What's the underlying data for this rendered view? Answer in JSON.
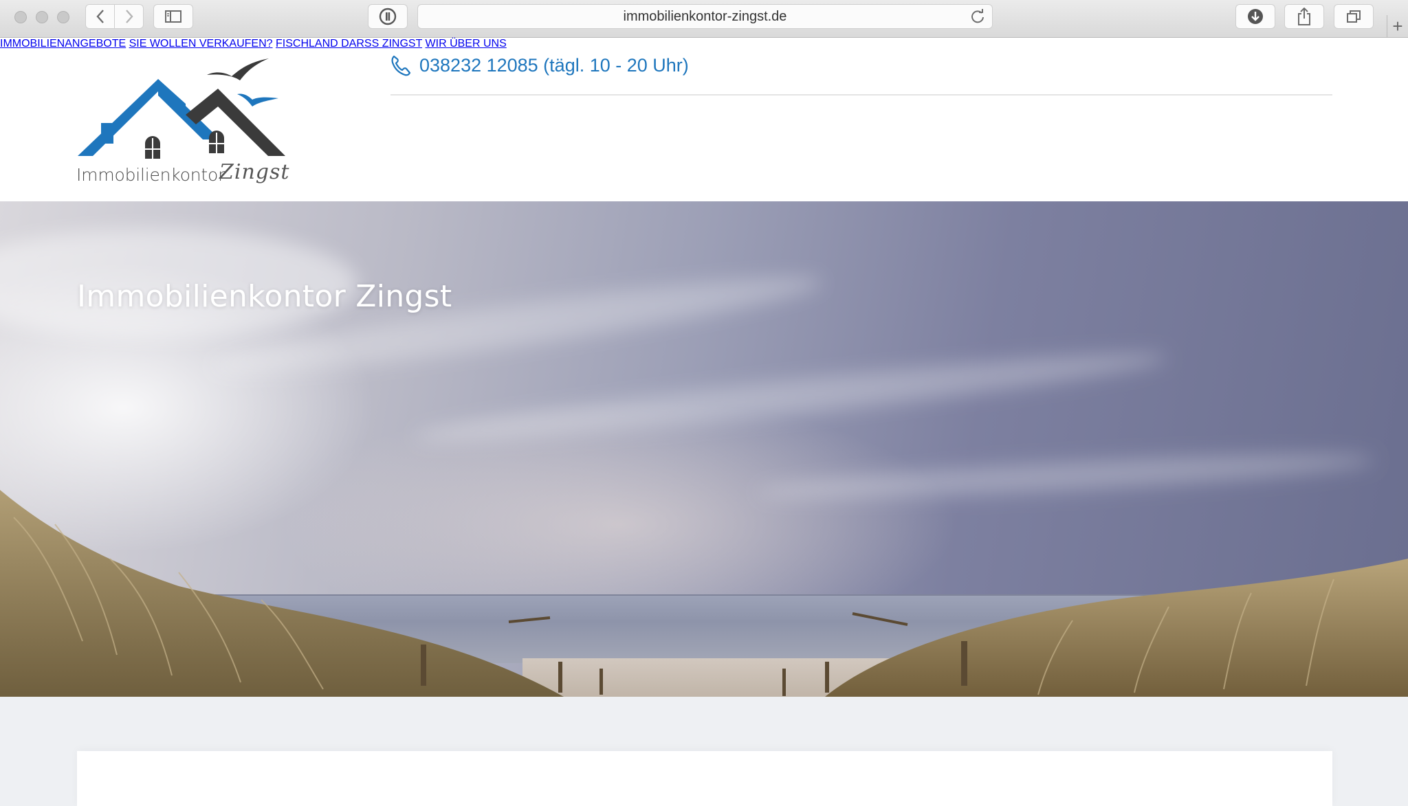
{
  "browser": {
    "url": "immobilienkontor-zingst.de",
    "new_tab_symbol": "+",
    "icons": [
      "back-icon",
      "forward-icon",
      "sidebar-icon",
      "privacy-report-icon",
      "reload-icon",
      "download-icon",
      "share-icon",
      "tabs-overview-icon",
      "new-tab-icon"
    ]
  },
  "header": {
    "logo_text": "Immobilienkontor",
    "logo_script": "Zingst",
    "phone": "038232 12085 (tägl. 10 - 20 Uhr)",
    "colors": {
      "accent": "#1e76bd",
      "roof_dark": "#3b3b3b"
    }
  },
  "nav": {
    "items": [
      {
        "label": "IMMOBILIENANGEBOTE"
      },
      {
        "label": "SIE WOLLEN VERKAUFEN?"
      },
      {
        "label": "FISCHLAND DARSS ZINGST"
      },
      {
        "label": "WIR ÜBER UNS"
      }
    ]
  },
  "hero": {
    "title": "Immobilienkontor Zingst"
  }
}
